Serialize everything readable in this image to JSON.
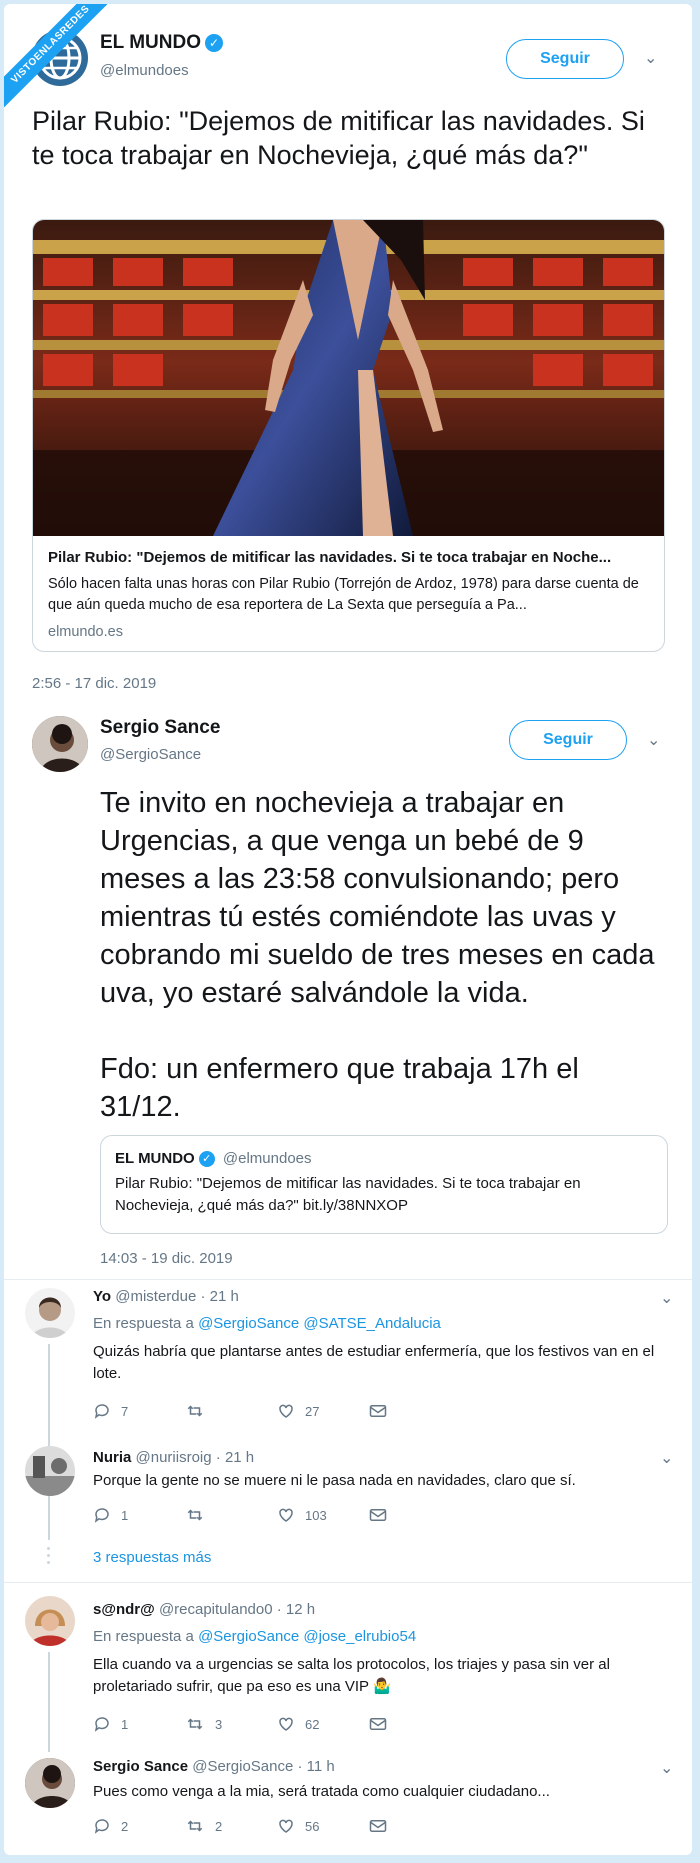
{
  "watermark": "VISTOENLASREDES",
  "tweet1": {
    "name": "EL MUNDO",
    "handle": "@elmundoes",
    "follow": "Seguir",
    "text": "Pilar Rubio: \"Dejemos de mitificar las navidades. Si te toca trabajar en Nochevieja, ¿qué más da?\"",
    "card_title": "Pilar Rubio: \"Dejemos de mitificar las navidades. Si te toca trabajar en Noche...",
    "card_desc": "Sólo hacen falta unas horas con Pilar Rubio (Torrejón de Ardoz, 1978) para darse cuenta de que aún queda mucho de esa reportera de La Sexta que perseguía a Pa...",
    "card_domain": "elmundo.es",
    "timestamp": "2:56 - 17 dic. 2019"
  },
  "tweet2": {
    "name": "Sergio Sance",
    "handle": "@SergioSance",
    "follow": "Seguir",
    "text1": "Te invito en nochevieja a trabajar en Urgencias, a que venga un bebé de 9 meses a las 23:58 convulsionando; pero mientras tú estés comiéndote las uvas y cobrando mi sueldo de tres meses en cada uva, yo estaré salvándole la vida.",
    "text2": "Fdo: un enfermero que trabaja 17h el 31/12.",
    "quote_name": "EL MUNDO",
    "quote_handle": "@elmundoes",
    "quote_text": "Pilar Rubio: \"Dejemos de mitificar las navidades. Si te toca trabajar en Nochevieja, ¿qué más da?\" bit.ly/38NNXOP",
    "timestamp": "14:03 - 19 dic. 2019"
  },
  "replies": [
    {
      "name": "Yo",
      "handle": "@misterdue",
      "time": "· 21 h",
      "reply_to_prefix": "En respuesta a",
      "reply_to": "@SergioSance @SATSE_Andalucia",
      "text": "Quizás habría que plantarse antes de estudiar enfermería, que los festivos van en el lote.",
      "replies": "7",
      "retweets": "",
      "likes": "27"
    },
    {
      "name": "Nuria",
      "handle": "@nuriisroig",
      "time": "· 21 h",
      "text": "Porque la gente no se muere ni le pasa nada en navidades, claro que sí.",
      "replies": "1",
      "retweets": "",
      "likes": "103"
    },
    {
      "name": "s@ndr@",
      "handle": "@recapitulando0",
      "time": "· 12 h",
      "reply_to_prefix": "En respuesta a",
      "reply_to": "@SergioSance @jose_elrubio54",
      "text": "Ella cuando va a urgencias se salta los protocolos, los triajes y pasa sin ver al proletariado sufrir, que pa eso es una VIP 🤷‍♂️",
      "replies": "1",
      "retweets": "3",
      "likes": "62"
    },
    {
      "name": "Sergio Sance",
      "handle": "@SergioSance",
      "time": "· 11 h",
      "text": "Pues como venga a la mia, será tratada como cualquier ciudadano...",
      "replies": "2",
      "retweets": "2",
      "likes": "56"
    }
  ],
  "more_replies": "3 respuestas más",
  "colors": {
    "accent": "#1da1f2",
    "link": "#1b95e0",
    "muted": "#657786"
  }
}
